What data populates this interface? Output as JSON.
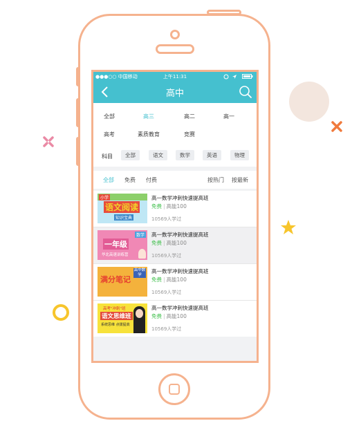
{
  "status_bar": {
    "carrier": "●●●○○ 中国移动",
    "time": "上午11:31"
  },
  "nav": {
    "title": "高中"
  },
  "grades": [
    "全部",
    "高三",
    "高二",
    "高一",
    "高考",
    "素质教育",
    "竞赛"
  ],
  "subject_label": "科目",
  "subjects": [
    "全部",
    "语文",
    "数学",
    "英语",
    "物理"
  ],
  "sort": {
    "all": "全部",
    "free": "免费",
    "paid": "付费",
    "hot": "按热门",
    "newest": "按最新"
  },
  "courses": [
    {
      "title": "高一数学冲刺快速提高班",
      "price": "免费",
      "teacher": "高能100",
      "learners": "10569人学过",
      "thumb_text": "语文阅读",
      "thumb_tag": "小学",
      "thumb_sub": "知识宝典"
    },
    {
      "title": "高一数学冲刺快速提高班",
      "price": "免费",
      "teacher": "高能100",
      "learners": "10569人学过",
      "thumb_text": "一年级",
      "thumb_tag": "数学",
      "thumb_sub": "华北高速训练营"
    },
    {
      "title": "高一数学冲刺快速提高班",
      "price": "免费",
      "teacher": "高能100",
      "learners": "10569人学过",
      "thumb_text": "满分笔记",
      "thumb_tag": "高中数学",
      "thumb_sub": ""
    },
    {
      "title": "高一数学冲刺快速提高班",
      "price": "免费",
      "teacher": "高能100",
      "learners": "10569人学过",
      "thumb_text": "语文思维班",
      "thumb_tag": "高考\"冲刺\"班",
      "thumb_sub": "系统思维 点拨提高"
    }
  ],
  "colors": {
    "accent": "#45c0cf",
    "phone_outline": "#f5b28e",
    "free_green": "#3fbf4b"
  }
}
